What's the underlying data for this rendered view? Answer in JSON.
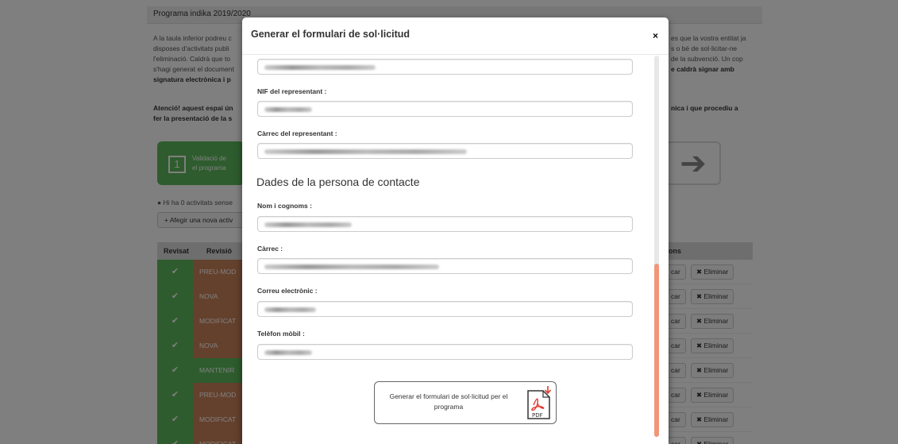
{
  "background": {
    "panel_title": "Programa indika 2019/2020",
    "intro_lines": [
      "A la taula inferior podreu c",
      "disposes d'activitats publi",
      "l'eliminació. Caldrà que to",
      "s'hagi generat el document"
    ],
    "intro_bold": "signatura electrònica i p",
    "intro_right_lines": [
      "es que la vostra entitat ja",
      "s o bé de sol·licitar-ne",
      "de la subvenció. Un cop",
      "e caldrà signar amb"
    ],
    "warning_left": "Atenció! aquest espai ún",
    "warning_left2": "fer la presentació de la s",
    "warning_right": "nica i que procediu a",
    "step_number": "1",
    "step_label_1": "Validació de",
    "step_label_2": "el programa",
    "arrow_glyph": "➔",
    "info_text": "Hi ha 0 activitats sense",
    "add_button_label": "Afegir una nova activ",
    "table_headers": {
      "col_revisat": "Revisat",
      "col_revisio": "Revisió",
      "col_accions": "ons"
    },
    "rows": [
      {
        "status": "PREU-MOD",
        "color": "#c9835a"
      },
      {
        "status": "NOVA",
        "color": "#c9835a"
      },
      {
        "status": "MODIFICAT",
        "color": "#c9835a"
      },
      {
        "status": "NOVA",
        "color": "#c9835a"
      },
      {
        "status": "MANTENIR",
        "color": "#5cb85c"
      },
      {
        "status": "PREU-MOD",
        "color": "#c9835a"
      },
      {
        "status": "MODIFICAT",
        "color": "#c9835a"
      },
      {
        "status": "MODIFICAT",
        "color": "#c9835a"
      }
    ],
    "edit_label": "car",
    "delete_label": "Eliminar",
    "check_glyph": "✔",
    "delete_glyph": "✖"
  },
  "modal": {
    "title": "Generar el formulari de sol·licitud",
    "close_glyph": "×",
    "fields": {
      "nif_label": "NIF del representant :",
      "carrec_rep_label": "Càrrec del representant :",
      "section_contact": "Dades de la persona de contacte",
      "nom_label": "Nom i cognoms :",
      "carrec_label": "Càrrec :",
      "correu_label": "Correu electrònic :",
      "telefon_label": "Telèfon mòbil :"
    },
    "generate_button_label": "Generar el formulari de sol·licitud per el programa",
    "pdf_icon_text": "PDF"
  },
  "colors": {
    "accent_green": "#5cb85c",
    "accent_orange": "#c9835a",
    "scroll_thumb": "#f0967a"
  }
}
